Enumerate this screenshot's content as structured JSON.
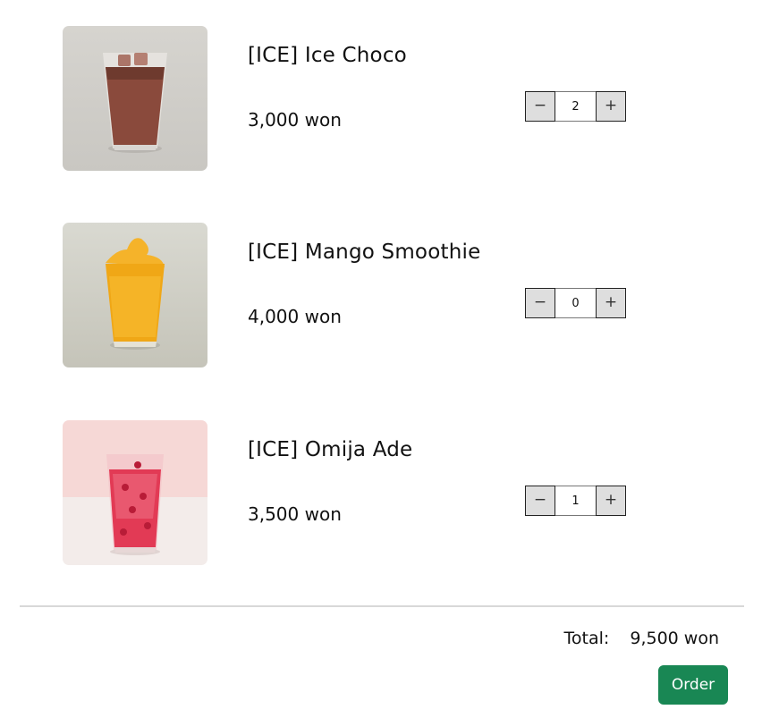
{
  "cart": {
    "items": [
      {
        "name": "[ICE] Ice Choco",
        "price": "3,000 won",
        "quantity": "2",
        "image": "ice-choco-drink-image",
        "decrease_label": "−",
        "increase_label": "+"
      },
      {
        "name": "[ICE] Mango Smoothie",
        "price": "4,000 won",
        "quantity": "0",
        "image": "mango-smoothie-drink-image",
        "decrease_label": "−",
        "increase_label": "+"
      },
      {
        "name": "[ICE] Omija Ade",
        "price": "3,500 won",
        "quantity": "1",
        "image": "omija-ade-drink-image",
        "decrease_label": "−",
        "increase_label": "+"
      }
    ]
  },
  "summary": {
    "total_label": "Total:",
    "total_value": "9,500 won"
  },
  "order_button": {
    "label": "Order",
    "color": "#198754"
  }
}
